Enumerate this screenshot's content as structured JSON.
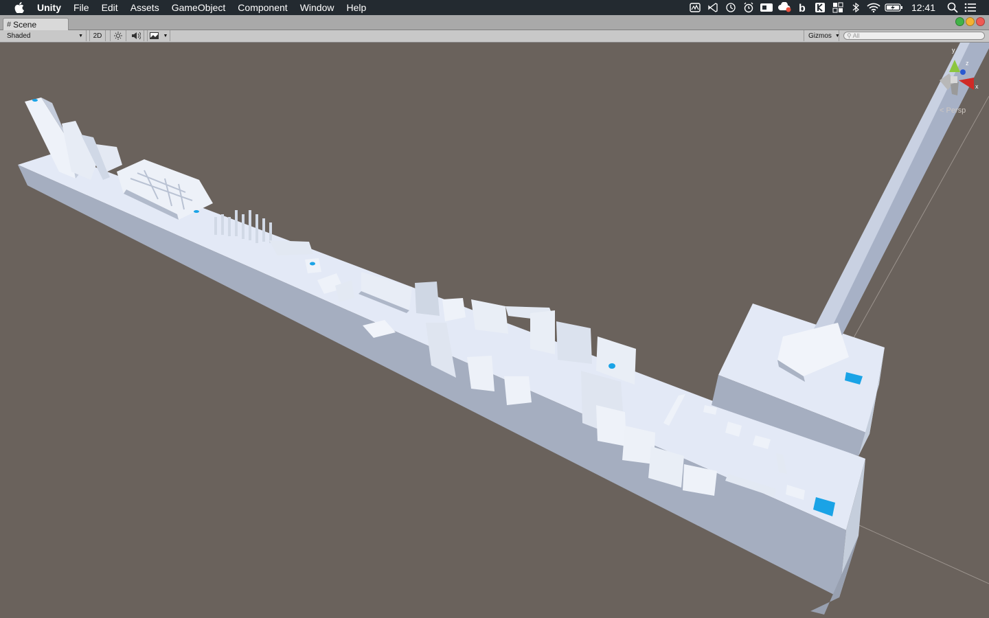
{
  "menubar": {
    "app_name": "Unity",
    "menus": [
      "File",
      "Edit",
      "Assets",
      "GameObject",
      "Component",
      "Window",
      "Help"
    ],
    "status_icons": [
      "activity-monitor-icon",
      "vscode-icon",
      "time-machine-icon",
      "alarm-icon",
      "screen-share-icon",
      "creative-cloud-icon",
      "bold-b-icon",
      "kite-icon",
      "mosaic-icon",
      "bluetooth-icon",
      "wifi-icon",
      "battery-charging-icon"
    ],
    "clock": "12:41"
  },
  "window": {
    "tab_label": "Scene",
    "traffic_colors": [
      "#41b347",
      "#f4b232",
      "#ee5a54"
    ]
  },
  "toolbar": {
    "draw_mode": "Shaded",
    "btn_2d": "2D",
    "gizmos_label": "Gizmos",
    "search_placeholder": "All"
  },
  "scene": {
    "background_color": "#6a625c",
    "geometry_color": "#e3e9f6",
    "accent_color": "#1aa3e6",
    "axis_labels": {
      "y": "y",
      "z": "z",
      "x": "x"
    },
    "projection_label": "< Persp"
  }
}
